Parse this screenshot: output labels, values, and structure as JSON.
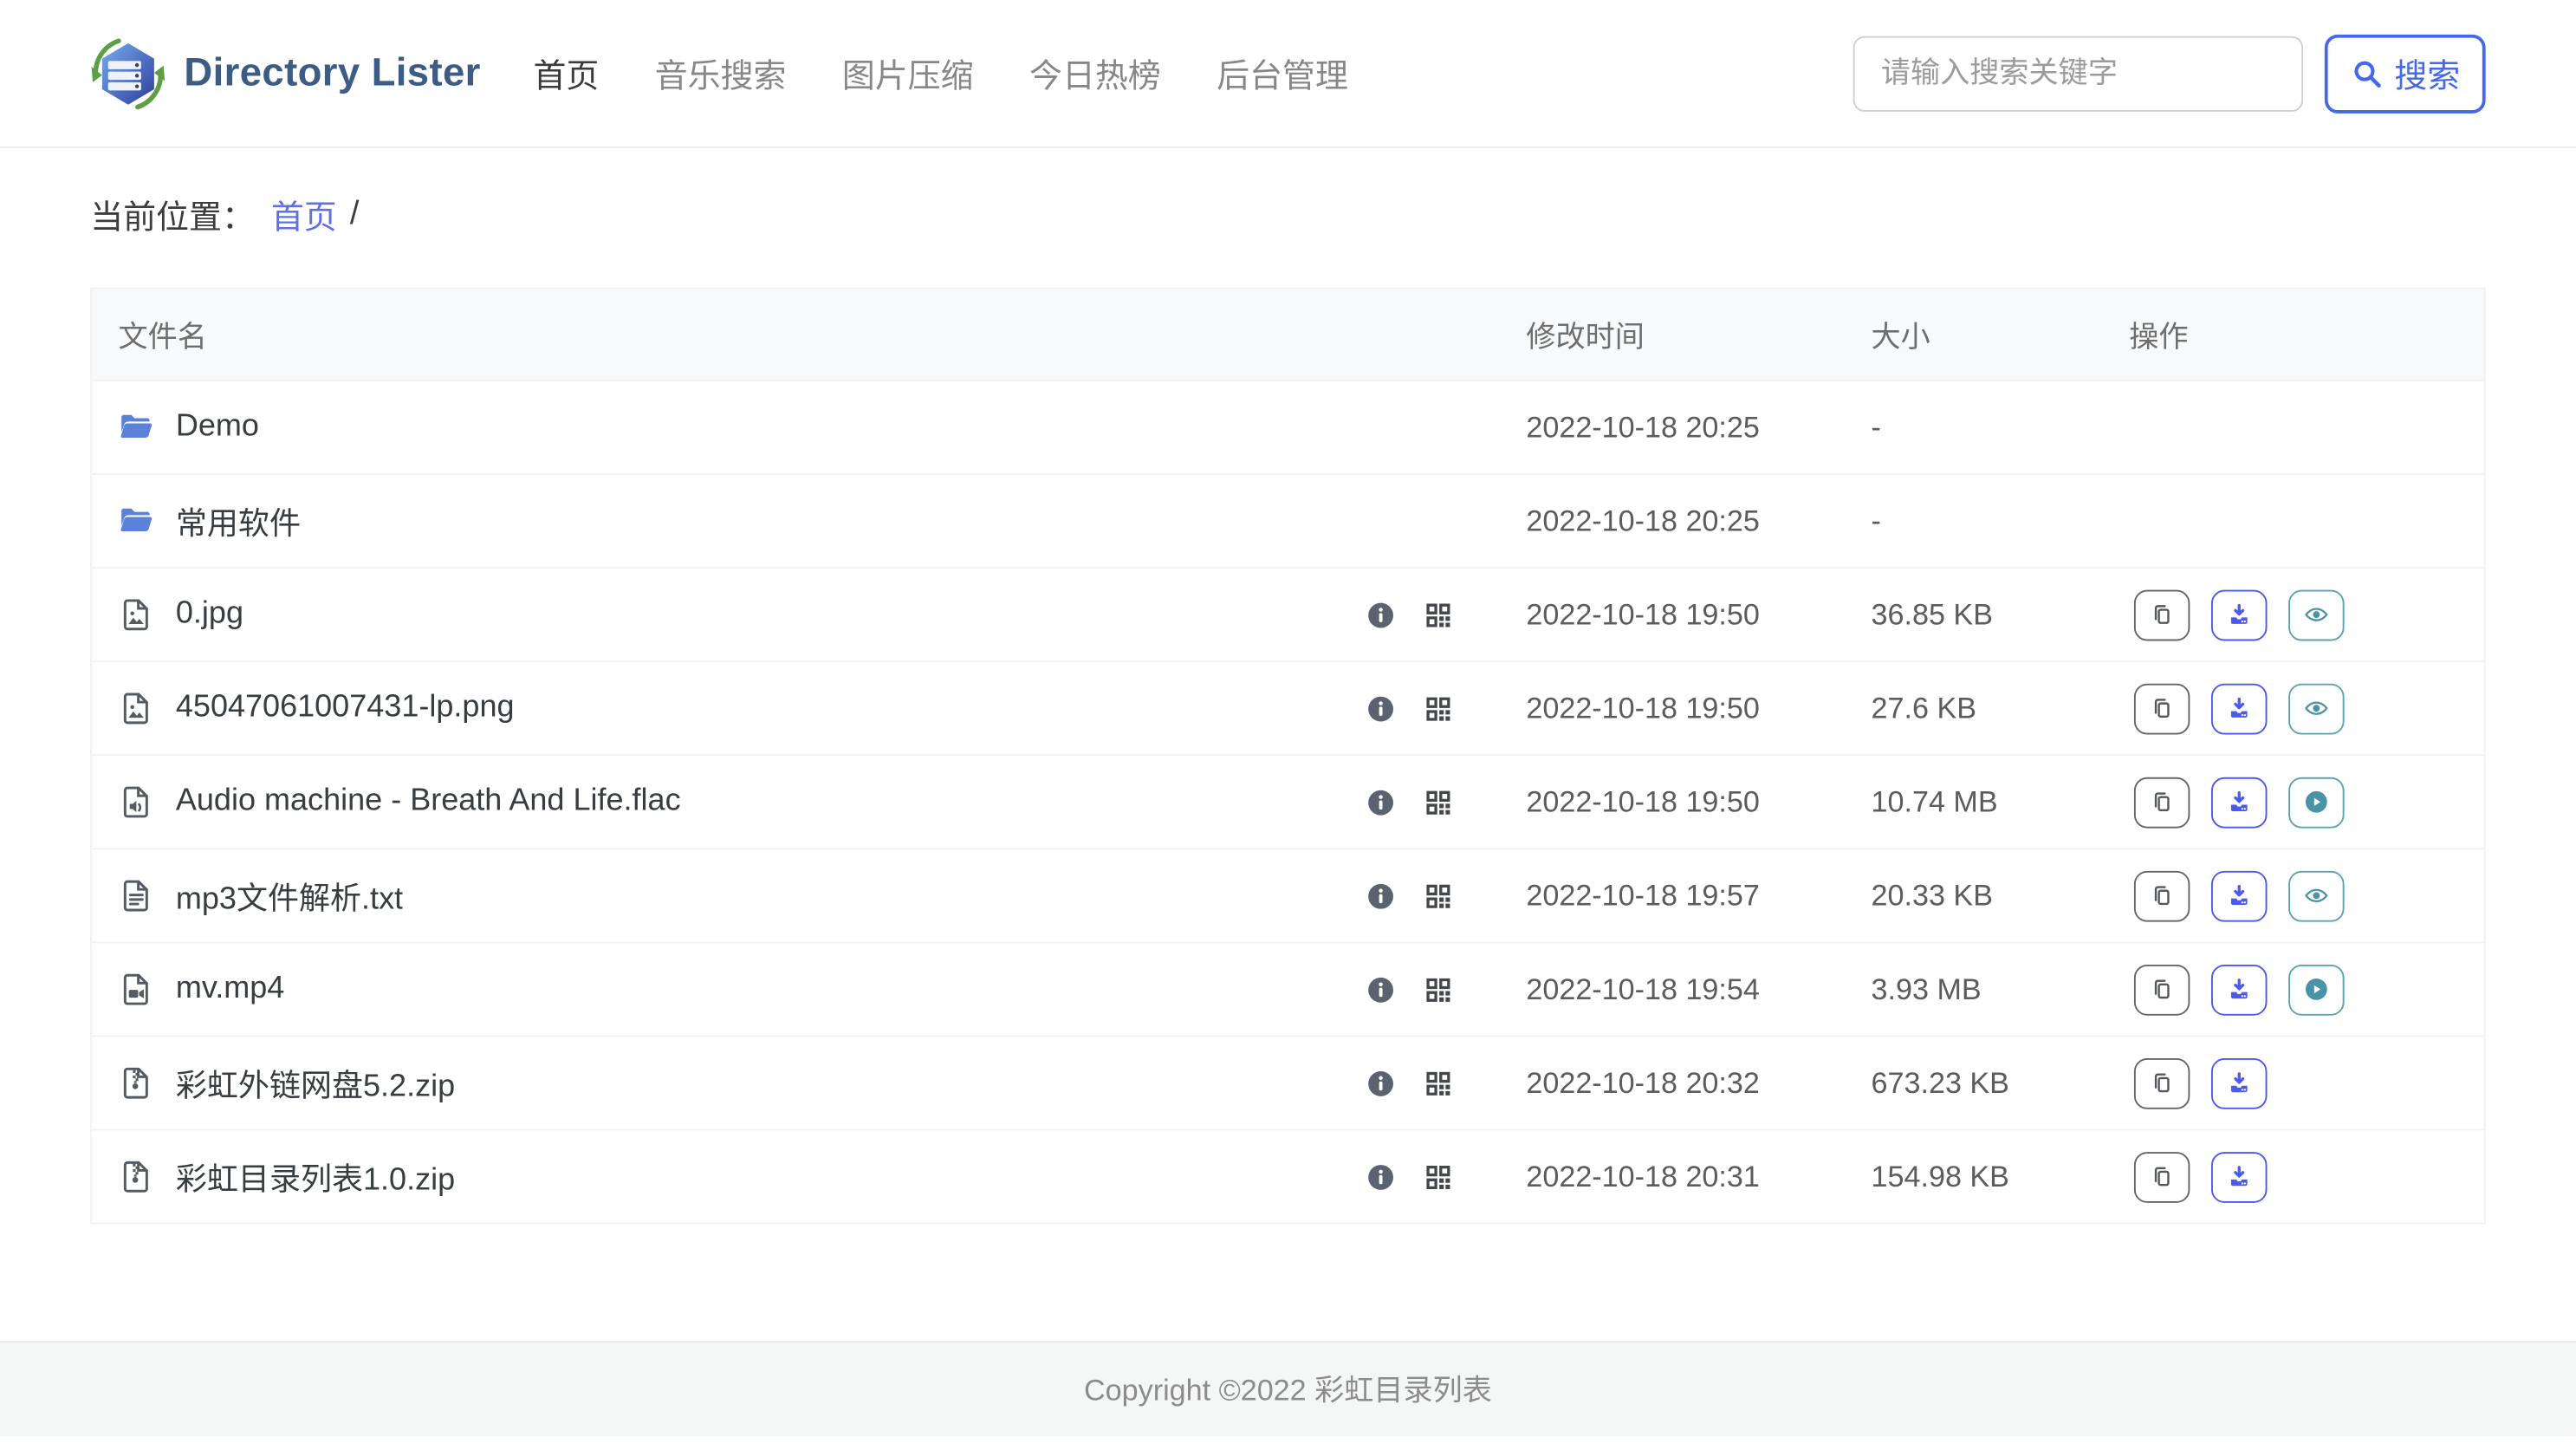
{
  "header": {
    "logo_text": "Directory Lister",
    "nav": [
      {
        "label": "首页",
        "active": true
      },
      {
        "label": "音乐搜索",
        "active": false
      },
      {
        "label": "图片压缩",
        "active": false
      },
      {
        "label": "今日热榜",
        "active": false
      },
      {
        "label": "后台管理",
        "active": false
      }
    ],
    "search": {
      "placeholder": "请输入搜索关键字",
      "button_label": "搜索"
    }
  },
  "breadcrumb": {
    "prefix": "当前位置：",
    "home": "首页",
    "separator": "/"
  },
  "table": {
    "headers": {
      "name": "文件名",
      "modified": "修改时间",
      "size": "大小",
      "actions": "操作"
    },
    "rows": [
      {
        "name": "Demo",
        "icon": "folder-icon",
        "modified": "2022-10-18 20:25",
        "size": "-",
        "meta_icons": [],
        "actions": []
      },
      {
        "name": "常用软件",
        "icon": "folder-icon",
        "modified": "2022-10-18 20:25",
        "size": "-",
        "meta_icons": [],
        "actions": []
      },
      {
        "name": "0.jpg",
        "icon": "image-file-icon",
        "modified": "2022-10-18 19:50",
        "size": "36.85 KB",
        "meta_icons": [
          "info-icon",
          "qrcode-icon"
        ],
        "actions": [
          "copy",
          "download",
          "view"
        ]
      },
      {
        "name": "45047061007431-lp.png",
        "icon": "image-file-icon",
        "modified": "2022-10-18 19:50",
        "size": "27.6 KB",
        "meta_icons": [
          "info-icon",
          "qrcode-icon"
        ],
        "actions": [
          "copy",
          "download",
          "view"
        ]
      },
      {
        "name": "Audio machine - Breath And Life.flac",
        "icon": "audio-file-icon",
        "modified": "2022-10-18 19:50",
        "size": "10.74 MB",
        "meta_icons": [
          "info-icon",
          "qrcode-icon"
        ],
        "actions": [
          "copy",
          "download",
          "play"
        ]
      },
      {
        "name": "mp3文件解析.txt",
        "icon": "text-file-icon",
        "modified": "2022-10-18 19:57",
        "size": "20.33 KB",
        "meta_icons": [
          "info-icon",
          "qrcode-icon"
        ],
        "actions": [
          "copy",
          "download",
          "view"
        ]
      },
      {
        "name": "mv.mp4",
        "icon": "video-file-icon",
        "modified": "2022-10-18 19:54",
        "size": "3.93 MB",
        "meta_icons": [
          "info-icon",
          "qrcode-icon"
        ],
        "actions": [
          "copy",
          "download",
          "play"
        ]
      },
      {
        "name": "彩虹外链网盘5.2.zip",
        "icon": "zip-file-icon",
        "modified": "2022-10-18 20:32",
        "size": "673.23 KB",
        "meta_icons": [
          "info-icon",
          "qrcode-icon"
        ],
        "actions": [
          "copy",
          "download"
        ]
      },
      {
        "name": "彩虹目录列表1.0.zip",
        "icon": "zip-file-icon",
        "modified": "2022-10-18 20:31",
        "size": "154.98 KB",
        "meta_icons": [
          "info-icon",
          "qrcode-icon"
        ],
        "actions": [
          "copy",
          "download"
        ]
      }
    ]
  },
  "footer": {
    "copyright": "Copyright ©2022 彩虹目录列表"
  },
  "colors": {
    "accent_blue": "#4468e8",
    "link_blue": "#5f6fe8",
    "download_blue": "#4b59ee",
    "teal": "#4a93a6",
    "folder_blue": "#5b82d8",
    "icon_gray": "#555b63",
    "header_bg": "#f8f9fa",
    "footer_bg": "#f5f6f6"
  }
}
